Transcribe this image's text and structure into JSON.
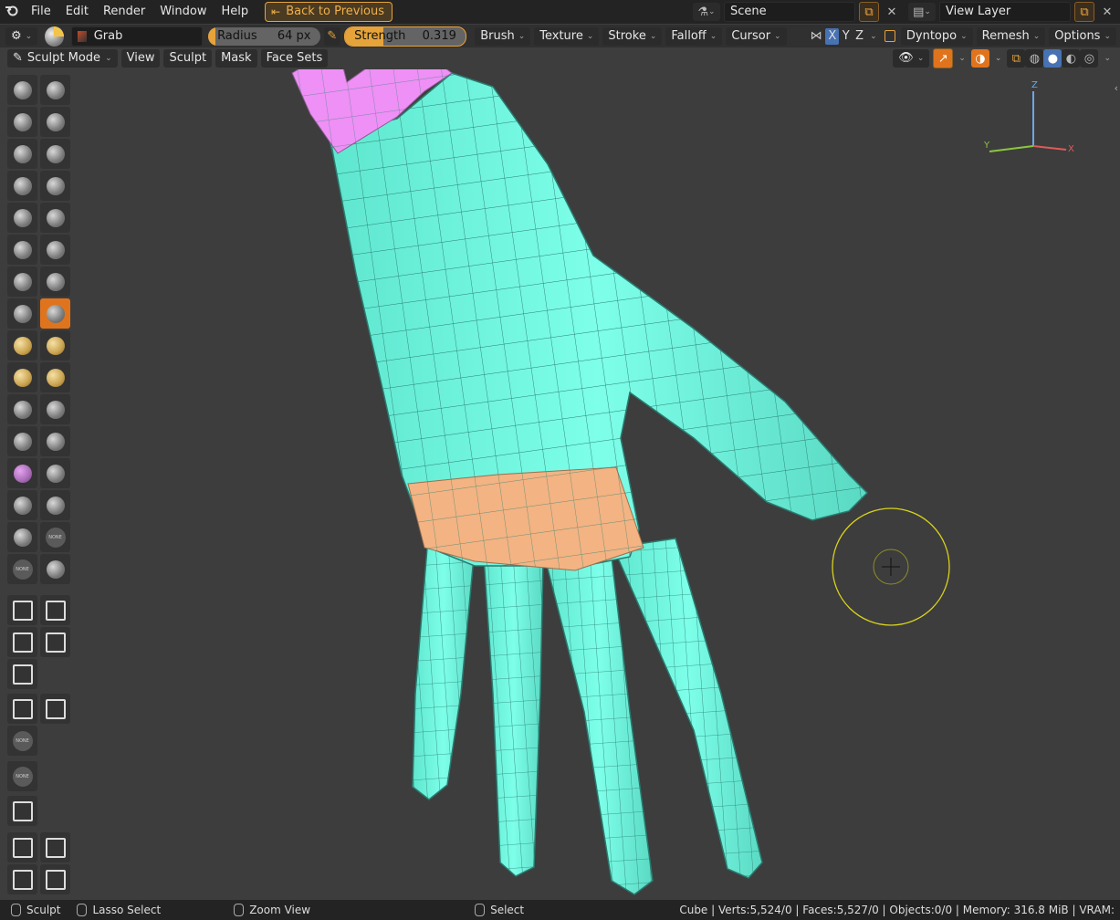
{
  "topbar": {
    "menus": [
      "File",
      "Edit",
      "Render",
      "Window",
      "Help"
    ],
    "back_label": "Back to Previous",
    "scene_label": "Scene",
    "view_layer_label": "View Layer"
  },
  "tool_header": {
    "brush_name": "Grab",
    "radius_label": "Radius",
    "radius_value": "64 px",
    "strength_label": "Strength",
    "strength_value": "0.319",
    "menus": [
      "Brush",
      "Texture",
      "Stroke",
      "Falloff",
      "Cursor"
    ],
    "axes": [
      "X",
      "Y",
      "Z"
    ],
    "dyntopo_label": "Dyntopo",
    "remesh_label": "Remesh",
    "options_label": "Options"
  },
  "viewport_header": {
    "mode_label": "Sculpt Mode",
    "menus": [
      "View",
      "Sculpt",
      "Mask",
      "Face Sets"
    ]
  },
  "gizmo": {
    "z": "Z",
    "y": "Y",
    "x": "X"
  },
  "toolbar": {
    "none_label": "NONE"
  },
  "status": {
    "left_tool": "Sculpt",
    "lasso": "Lasso Select",
    "zoom": "Zoom View",
    "select": "Select",
    "stats": "Cube | Verts:5,524/0 | Faces:5,527/0 | Objects:0/0 | Memory: 316.8 MiB | VRAM:"
  },
  "colors": {
    "accent": "#e0741d",
    "mesh": "#7affe8",
    "mask_pink": "#ee90f5",
    "mask_orange": "#f3b383",
    "brush_circle": "#d8d21e"
  }
}
